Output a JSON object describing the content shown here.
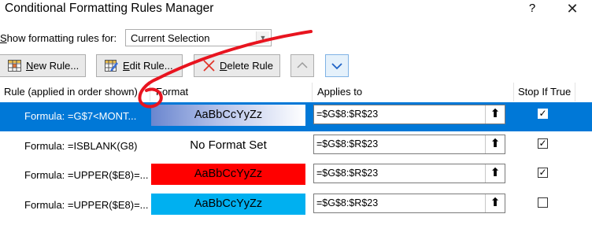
{
  "window": {
    "title": "Conditional Formatting Rules Manager",
    "help_glyph": "?",
    "close_glyph": "✕"
  },
  "scope": {
    "label_prefix": "S",
    "label_rest": "how formatting rules for:",
    "selected_value": "Current Selection"
  },
  "toolbar": {
    "new_rule_underline": "N",
    "new_rule_rest": "ew Rule...",
    "edit_rule_underline": "E",
    "edit_rule_rest": "dit Rule...",
    "delete_rule_underline": "D",
    "delete_rule_rest": "elete Rule"
  },
  "table": {
    "headers": {
      "rule": "Rule (applied in order shown)",
      "format": "Format",
      "applies_to": "Applies to",
      "stop_if_true": "Stop If True"
    },
    "rows": [
      {
        "rule": "Formula: =G$7<MONT...",
        "format_text": "AaBbCcYyZz",
        "applies_to": "=$G$8:$R$23",
        "stop_if_true": true,
        "selected": true
      },
      {
        "rule": "Formula: =ISBLANK(G8)",
        "format_text": "No Format Set",
        "applies_to": "=$G$8:$R$23",
        "stop_if_true": true,
        "selected": false
      },
      {
        "rule": "Formula: =UPPER($E8)=...",
        "format_text": "AaBbCcYyZz",
        "applies_to": "=$G$8:$R$23",
        "stop_if_true": true,
        "selected": false
      },
      {
        "rule": "Formula: =UPPER($E8)=...",
        "format_text": "AaBbCcYyZz",
        "applies_to": "=$G$8:$R$23",
        "stop_if_true": false,
        "selected": false
      }
    ]
  },
  "colors": {
    "selection": "#0078d7",
    "row1_format_bg_gradient": [
      "#5b7fd1",
      "#ffffff"
    ],
    "row3_format_bg": "#ff0000",
    "row4_format_bg": "#00b0f0",
    "annotation": "#e8141f"
  },
  "icons": [
    "question-mark-icon",
    "close-icon",
    "new-rule-icon",
    "edit-rule-icon",
    "delete-x-icon",
    "move-up-icon",
    "move-down-icon",
    "range-select-icon",
    "checkbox-checked-icon"
  ]
}
